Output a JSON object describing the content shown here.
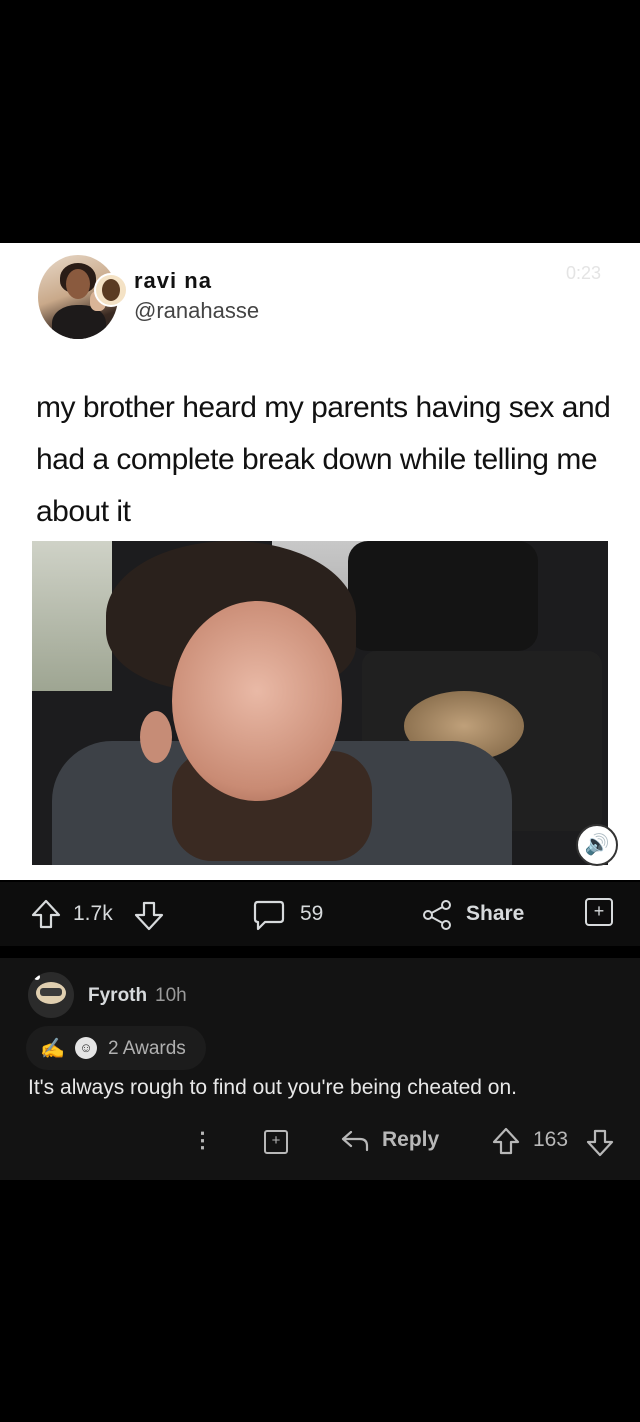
{
  "tweet": {
    "display_name": "ravi na",
    "handle": "@ranahasse",
    "video_time": "0:23",
    "text": "my brother heard my parents having sex and had a complete break down while telling me about it"
  },
  "post_actions": {
    "upvotes": "1.7k",
    "comments": "59",
    "share_label": "Share"
  },
  "comment": {
    "author": "Fyroth",
    "age": "10h",
    "awards_label": "2 Awards",
    "body": "It's always rough to find out you're being cheated on.",
    "reply_label": "Reply",
    "score": "163",
    "more_glyph": "⋮"
  },
  "colors": {
    "card_bg": "#ffffff",
    "page_bg": "#000000",
    "comment_bg": "#131313",
    "text": "#d7dadc"
  }
}
